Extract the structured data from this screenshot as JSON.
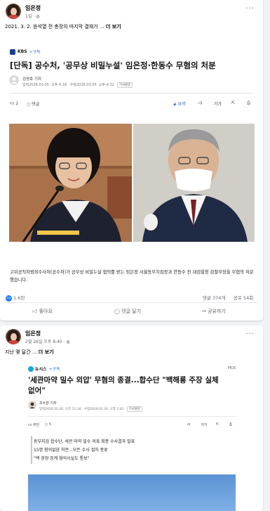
{
  "post1": {
    "author": "임은정",
    "time": "1일 · ",
    "text_prefix": "2021. 3. 2. 윤석열 전 총장의 마지막 결재가 ... ",
    "more_label": "더 보기",
    "more_menu": "···",
    "article": {
      "source": "KBS",
      "subscribe": "+구독",
      "headline": "[단독] 공수처, '공무상 비밀누설' 임은정·한동수 무혐의 처분",
      "reporter": "김영호 기자",
      "dateline": "입력2026.03.05. 오후 4:18 · 수정2026.03.05. 오후 4:32",
      "original_label": "기사원문",
      "reaction_count": "2",
      "comment_label": "댓글",
      "summary_label": "요약",
      "font_label": "가가",
      "caption": "고위공직자범죄수사처(공수처)가 공무상 비밀누설 혐의를 받는 임은정 서울동부지검장과 한동수 전 대검찰청 감찰부장을 무혐의 처분했습니다."
    },
    "likes": "1.6천",
    "comments": "댓글 374개",
    "shares": "공유 54회",
    "actions": {
      "like": "좋아요",
      "comment": "댓글 달기",
      "share": "공유하기"
    }
  },
  "post2": {
    "author": "임은정",
    "time": "2월 26일 오후 8:40 · ",
    "text_prefix": "지난 몇 달간 ... ",
    "more_label": "더 보기",
    "more_menu": "···",
    "article": {
      "source": "뉴시스",
      "subscribe": "+구독",
      "pick_label": "PICK",
      "headline_line1": "'세관마약 밀수 외압' 무혐의 종결...합수단 \"백해룡 주장 실체",
      "headline_line2": "없어\"",
      "reporter": "조수원 기자",
      "dateline": "입력2026.02.26. 오전 11:34 · 수정2026.02.26. 오후 1:43",
      "original_label": "기사원문",
      "recommend_label": "추천",
      "comment_count": "5",
      "font_label": "가가",
      "bullets": [
        "동부지검 합수단, 세관 마약 밀수 의혹 최종 수사결과 발표",
        "15명 혐의없음 처분...모든 수사 절차 종료",
        "\"백 경정 징계 혐의사실도 통보\""
      ]
    }
  },
  "colors": {
    "facebook_blue": "#1877f2",
    "kbs_navy": "#1b3f8f",
    "link_blue": "#2c6ff2"
  }
}
